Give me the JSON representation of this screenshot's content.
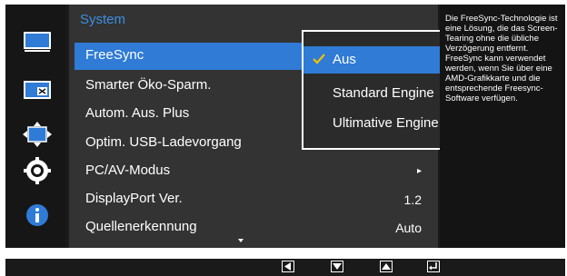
{
  "menu": {
    "title": "System",
    "items": [
      {
        "label": "FreeSync",
        "value": ""
      },
      {
        "label": "Smarter Öko-Sparm.",
        "value": ""
      },
      {
        "label": "Autom. Aus. Plus",
        "value": ""
      },
      {
        "label": "Optim. USB-Ladevorgang",
        "value": ""
      },
      {
        "label": "PC/AV-Modus",
        "value": "▸"
      },
      {
        "label": "DisplayPort Ver.",
        "value": "1.2"
      },
      {
        "label": "Quellenerkennung",
        "value": "Auto"
      }
    ]
  },
  "popup": {
    "options": [
      {
        "label": "Aus",
        "selected": true
      },
      {
        "label": "Standard Engine",
        "selected": false
      },
      {
        "label": "Ultimative Engine",
        "selected": false
      }
    ]
  },
  "help": {
    "text": "Die FreeSync-Technologie ist eine Lösung, die das Screen-Tearing ohne die übliche Verzögerung entfernt. FreeSync kann verwendet werden, wenn Sie über eine AMD-Grafikkarte und die entsprechende Freesync-Software verfügen."
  },
  "sidebar": {
    "icons": [
      "monitor-icon",
      "picture-in-picture-icon",
      "resize-arrows-icon",
      "gear-icon",
      "info-icon"
    ]
  },
  "controls": {
    "icons": [
      "left-arrow-icon",
      "down-arrow-icon",
      "up-arrow-icon",
      "enter-icon"
    ]
  },
  "colors": {
    "accent": "#2f7bd6",
    "title": "#3b8fe0",
    "panel": "#333333",
    "background": "#1a1a1a"
  }
}
